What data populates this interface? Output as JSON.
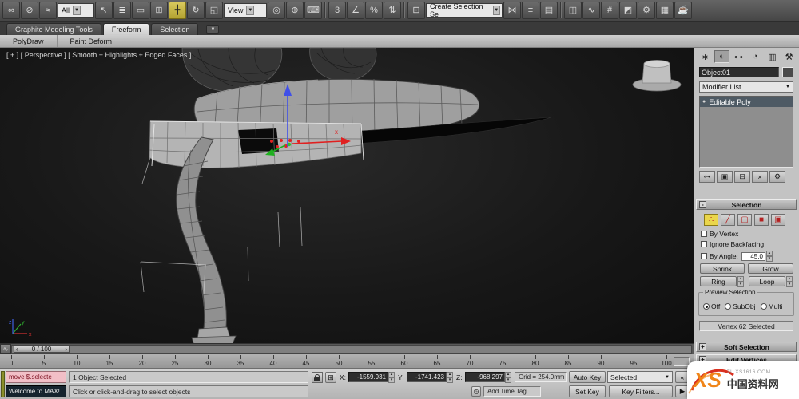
{
  "icons": {
    "select_link": "∞",
    "unlink": "⊘",
    "bind_spacewarp": "≈",
    "select_object": "↖",
    "select_by_name": "≣",
    "rect_region": "▭",
    "window_crossing": "⊞",
    "move": "╋",
    "rotate": "↻",
    "scale": "◱",
    "pivot_center": "◎",
    "manipulate": "⊕",
    "kbd_override": "⌨",
    "snap_3d": "3",
    "angle_snap": "∠",
    "percent_snap": "%",
    "spinner_snap": "⇅",
    "named_sets": "⊡",
    "mirror": "⋈",
    "align": "≡",
    "layers": "▤",
    "ribbon_toggle": "◫",
    "curve_editor": "∿",
    "schematic": "#",
    "material_editor": "◩",
    "render_setup": "⚙",
    "rendered_frame": "▦",
    "render": "☕",
    "panel_create": "∗",
    "panel_modify": "◐",
    "panel_hierarchy": "⊶",
    "panel_motion": "◔",
    "panel_display": "▥",
    "panel_utilities": "⚒",
    "pin_stack": "⊶",
    "show_end": "▣",
    "make_unique": "⊟",
    "remove_modifier": "×",
    "configure": "⚙",
    "sub_vertex": "∴",
    "sub_edge": "╱",
    "sub_border": "▢",
    "sub_polygon": "■",
    "sub_element": "▣",
    "dd_arrow": "▼",
    "spin_up": "▴",
    "spin_down": "▾",
    "tick_prev": "‹",
    "tick_next": "›",
    "playback_rew": "«",
    "playback_play": "▶",
    "mini_curve": "∿",
    "time_tag": "◷",
    "stack_bulb": "●",
    "abs_mode": "⊞"
  },
  "toolbar": {
    "selection_filter": "All",
    "ref_coord": "View",
    "named_sel": "Create Selection Se"
  },
  "ribbon": {
    "tabs": [
      {
        "label": "Graphite Modeling Tools"
      },
      {
        "label": "Freeform"
      },
      {
        "label": "Selection"
      }
    ],
    "panels": [
      {
        "label": "PolyDraw"
      },
      {
        "label": "Paint Deform"
      }
    ]
  },
  "viewport": {
    "label": "[ + ] [ Perspective ] [ Smooth + Highlights + Edged Faces ]",
    "gizmo_x": "x",
    "axis_x": "x",
    "axis_y": "y",
    "axis_z": "z"
  },
  "timeline": {
    "slider": "0 / 100",
    "ticks": [
      "0",
      "5",
      "10",
      "15",
      "20",
      "25",
      "30",
      "35",
      "40",
      "45",
      "50",
      "55",
      "60",
      "65",
      "70",
      "75",
      "80",
      "85",
      "90",
      "95",
      "100"
    ]
  },
  "panel": {
    "object_name": "Object01",
    "modifier_list": "Modifier List",
    "stack_item": "Editable Poly",
    "minus": "-",
    "plus": "+",
    "selection": {
      "title": "Selection",
      "by_vertex": "By Vertex",
      "ignore_backfacing": "Ignore Backfacing",
      "by_angle": "By Angle:",
      "angle_value": "45.0",
      "shrink": "Shrink",
      "grow": "Grow",
      "ring": "Ring",
      "loop": "Loop",
      "preview": "Preview Selection",
      "off": "Off",
      "subobj": "SubObj",
      "multi": "Multi",
      "status": "Vertex 62 Selected"
    },
    "soft_selection": "Soft Selection",
    "edit_vertices": "Edit Vertices"
  },
  "status": {
    "macro_line": "move $.selecte",
    "welcome": "Welcome to MAX!",
    "objects_selected": "1 Object Selected",
    "prompt": "Click or click-and-drag to select objects",
    "x_label": "X:",
    "y_label": "Y:",
    "z_label": "Z:",
    "x_value": "-1559.931",
    "y_value": "-1741.423",
    "z_value": "-968.297",
    "grid": "Grid = 254.0mm",
    "add_time_tag": "Add Time Tag",
    "auto_key": "Auto Key",
    "set_key": "Set Key",
    "selected_dd": "Selected",
    "key_filters": "Key Filters..."
  },
  "watermark": {
    "site": "ZL.XS1616.COM",
    "brand": "中国资料网",
    "logo": "XS"
  }
}
